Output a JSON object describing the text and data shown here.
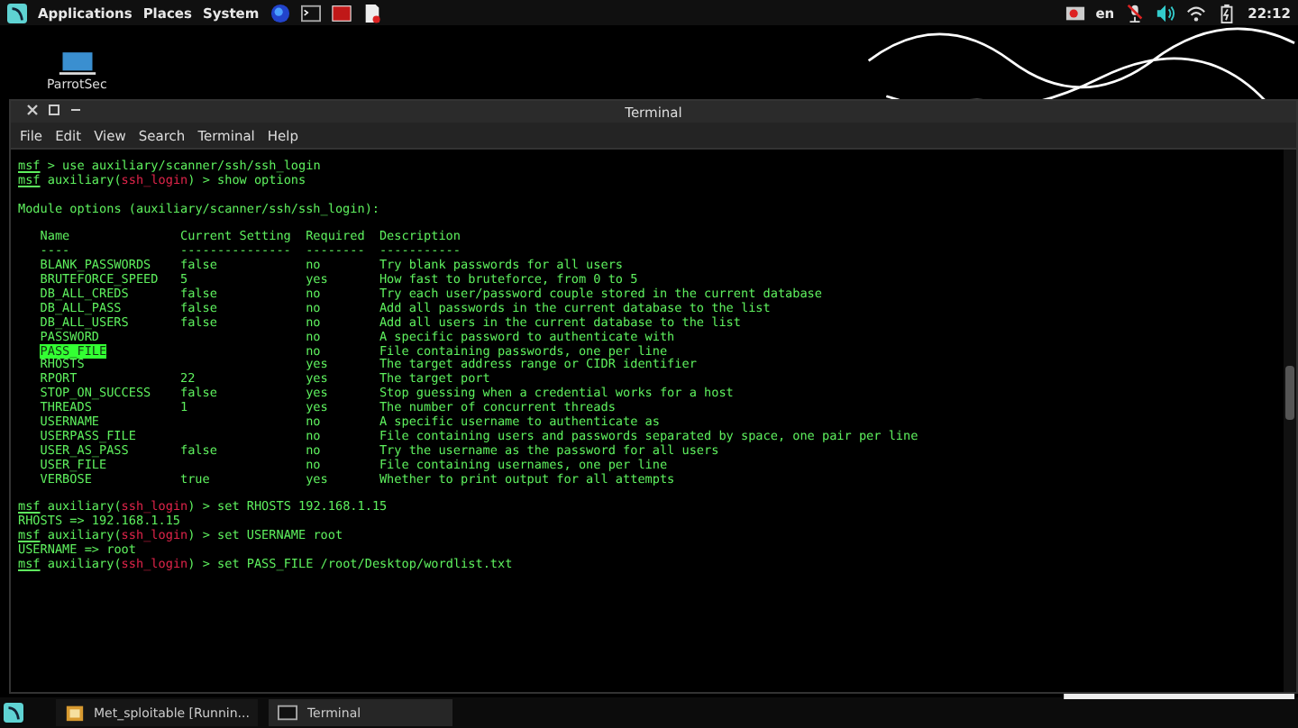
{
  "top_panel": {
    "menus": [
      "Applications",
      "Places",
      "System"
    ],
    "keyboard_layout": "en",
    "clock": "22:12"
  },
  "desktop_icons": [
    {
      "label": "ParrotSec"
    }
  ],
  "window": {
    "title": "Terminal",
    "menu": [
      "File",
      "Edit",
      "View",
      "Search",
      "Terminal",
      "Help"
    ]
  },
  "terminal": {
    "lines": [
      {
        "kind": "prompt",
        "parts": [
          {
            "text": "msf",
            "kind": "prompt"
          },
          {
            "text": " > use auxiliary/scanner/ssh/ssh_login",
            "kind": "text"
          }
        ]
      },
      {
        "kind": "prompt",
        "parts": [
          {
            "text": "msf",
            "kind": "prompt"
          },
          {
            "text": " auxiliary(",
            "kind": "text"
          },
          {
            "text": "ssh_login",
            "kind": "module"
          },
          {
            "text": ") > show options",
            "kind": "text"
          }
        ]
      },
      {
        "kind": "blank"
      },
      {
        "kind": "output",
        "text": "Module options (auxiliary/scanner/ssh/ssh_login):"
      },
      {
        "kind": "blank"
      }
    ],
    "table": {
      "columns": [
        "Name",
        "Current Setting",
        "Required",
        "Description"
      ],
      "rules": [
        "----",
        "---------------",
        "--------",
        "-----------"
      ],
      "rows": [
        {
          "name": "BLANK_PASSWORDS",
          "setting": "false",
          "required": "no",
          "description": "Try blank passwords for all users",
          "selected": false
        },
        {
          "name": "BRUTEFORCE_SPEED",
          "setting": "5",
          "required": "yes",
          "description": "How fast to bruteforce, from 0 to 5",
          "selected": false
        },
        {
          "name": "DB_ALL_CREDS",
          "setting": "false",
          "required": "no",
          "description": "Try each user/password couple stored in the current database",
          "selected": false
        },
        {
          "name": "DB_ALL_PASS",
          "setting": "false",
          "required": "no",
          "description": "Add all passwords in the current database to the list",
          "selected": false
        },
        {
          "name": "DB_ALL_USERS",
          "setting": "false",
          "required": "no",
          "description": "Add all users in the current database to the list",
          "selected": false
        },
        {
          "name": "PASSWORD",
          "setting": "",
          "required": "no",
          "description": "A specific password to authenticate with",
          "selected": false
        },
        {
          "name": "PASS_FILE",
          "setting": "",
          "required": "no",
          "description": "File containing passwords, one per line",
          "selected": true
        },
        {
          "name": "RHOSTS",
          "setting": "",
          "required": "yes",
          "description": "The target address range or CIDR identifier",
          "selected": false
        },
        {
          "name": "RPORT",
          "setting": "22",
          "required": "yes",
          "description": "The target port",
          "selected": false
        },
        {
          "name": "STOP_ON_SUCCESS",
          "setting": "false",
          "required": "yes",
          "description": "Stop guessing when a credential works for a host",
          "selected": false
        },
        {
          "name": "THREADS",
          "setting": "1",
          "required": "yes",
          "description": "The number of concurrent threads",
          "selected": false
        },
        {
          "name": "USERNAME",
          "setting": "",
          "required": "no",
          "description": "A specific username to authenticate as",
          "selected": false
        },
        {
          "name": "USERPASS_FILE",
          "setting": "",
          "required": "no",
          "description": "File containing users and passwords separated by space, one pair per line",
          "selected": false
        },
        {
          "name": "USER_AS_PASS",
          "setting": "false",
          "required": "no",
          "description": "Try the username as the password for all users",
          "selected": false
        },
        {
          "name": "USER_FILE",
          "setting": "",
          "required": "no",
          "description": "File containing usernames, one per line",
          "selected": false
        },
        {
          "name": "VERBOSE",
          "setting": "true",
          "required": "yes",
          "description": "Whether to print output for all attempts",
          "selected": false
        }
      ]
    },
    "after": [
      {
        "kind": "blank"
      },
      {
        "kind": "prompt",
        "parts": [
          {
            "text": "msf",
            "kind": "prompt"
          },
          {
            "text": " auxiliary(",
            "kind": "text"
          },
          {
            "text": "ssh_login",
            "kind": "module"
          },
          {
            "text": ") > set RHOSTS 192.168.1.15",
            "kind": "text"
          }
        ]
      },
      {
        "kind": "output",
        "text": "RHOSTS => 192.168.1.15"
      },
      {
        "kind": "prompt",
        "parts": [
          {
            "text": "msf",
            "kind": "prompt"
          },
          {
            "text": " auxiliary(",
            "kind": "text"
          },
          {
            "text": "ssh_login",
            "kind": "module"
          },
          {
            "text": ") > set USERNAME root",
            "kind": "text"
          }
        ]
      },
      {
        "kind": "output",
        "text": "USERNAME => root"
      },
      {
        "kind": "prompt",
        "parts": [
          {
            "text": "msf",
            "kind": "prompt"
          },
          {
            "text": " auxiliary(",
            "kind": "text"
          },
          {
            "text": "ssh_login",
            "kind": "module"
          },
          {
            "text": ") > set PASS_FILE /root/Desktop/wordlist.txt",
            "kind": "text"
          }
        ]
      }
    ]
  },
  "taskbar": {
    "items": [
      {
        "label": "Met_sploitable [Runnin...",
        "kind": "vm",
        "selected": false
      },
      {
        "label": "Terminal",
        "kind": "terminal",
        "selected": true
      }
    ]
  }
}
